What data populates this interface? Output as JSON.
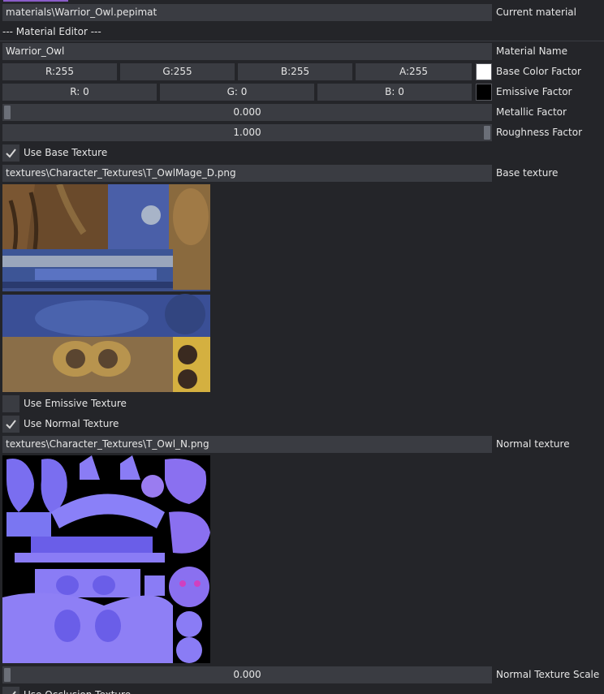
{
  "current_material": {
    "value": "materials\\Warrior_Owl.pepimat",
    "label": "Current material"
  },
  "editor_heading": "--- Material Editor ---",
  "material_name": {
    "value": "Warrior_Owl",
    "label": "Material Name"
  },
  "base_color": {
    "r": "R:255",
    "g": "G:255",
    "b": "B:255",
    "a": "A:255",
    "label": "Base Color Factor",
    "swatch": "#ffffff"
  },
  "emissive": {
    "r": "R:  0",
    "g": "G:  0",
    "b": "B:  0",
    "label": "Emissive Factor",
    "swatch": "#000000"
  },
  "metallic": {
    "value": "0.000",
    "label": "Metallic Factor",
    "fraction": 0.0
  },
  "roughness": {
    "value": "1.000",
    "label": "Roughness Factor",
    "fraction": 1.0
  },
  "use_base_texture": {
    "label": "Use Base Texture",
    "checked": true
  },
  "base_texture": {
    "value": "textures\\Character_Textures\\T_OwlMage_D.png",
    "label": "Base texture"
  },
  "use_emissive_texture": {
    "label": "Use Emissive Texture",
    "checked": false
  },
  "use_normal_texture": {
    "label": "Use Normal Texture",
    "checked": true
  },
  "normal_texture": {
    "value": "textures\\Character_Textures\\T_Owl_N.png",
    "label": "Normal texture"
  },
  "normal_scale": {
    "value": "0.000",
    "label": "Normal Texture Scale",
    "fraction": 0.0
  },
  "use_occlusion_texture": {
    "label": "Use Occlusion Texture",
    "checked": true
  },
  "colors": {
    "panel_bg": "#242529",
    "field_bg": "#3a3c42",
    "accent": "#8a5cc8"
  }
}
